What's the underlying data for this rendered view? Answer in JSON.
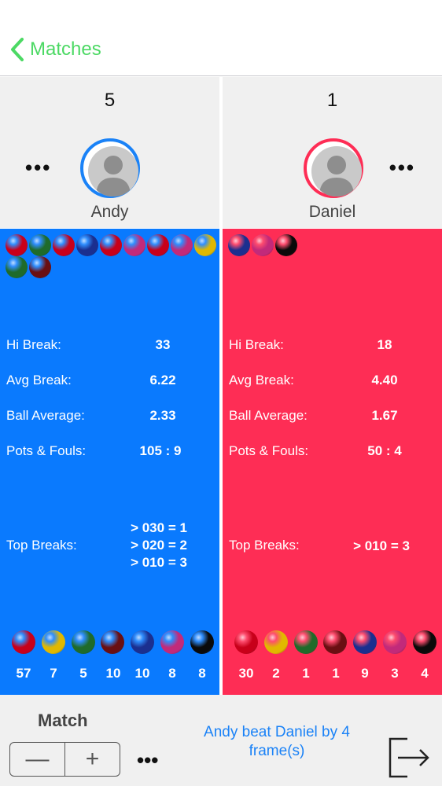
{
  "nav": {
    "back_label": "Matches"
  },
  "players": [
    {
      "score": "5",
      "name": "Andy",
      "panel_color": "#0a7afe",
      "ring_color": "#1a82f7",
      "potted_balls": [
        "red",
        "green",
        "red",
        "blue",
        "red",
        "pink",
        "red",
        "pink",
        "yellow",
        "green",
        "brown"
      ],
      "stats": {
        "hi_break_label": "Hi Break:",
        "hi_break": "33",
        "avg_break_label": "Avg Break:",
        "avg_break": "6.22",
        "ball_avg_label": "Ball Average:",
        "ball_avg": "2.33",
        "pots_fouls_label": "Pots & Fouls:",
        "pots_fouls": "105 : 9",
        "top_breaks_label": "Top Breaks:",
        "top_breaks": [
          "> 030 = 1",
          "> 020 = 2",
          "> 010 = 3"
        ]
      },
      "ball_counts": [
        "57",
        "7",
        "5",
        "10",
        "10",
        "8",
        "8"
      ]
    },
    {
      "score": "1",
      "name": "Daniel",
      "panel_color": "#fe2d55",
      "ring_color": "#fe2d55",
      "potted_balls": [
        "blue",
        "pink",
        "black"
      ],
      "stats": {
        "hi_break_label": "Hi Break:",
        "hi_break": "18",
        "avg_break_label": "Avg Break:",
        "avg_break": "4.40",
        "ball_avg_label": "Ball Average:",
        "ball_avg": "1.67",
        "pots_fouls_label": "Pots & Fouls:",
        "pots_fouls": "50 : 4",
        "top_breaks_label": "Top Breaks:",
        "top_breaks": [
          "> 010 = 3"
        ]
      },
      "ball_counts": [
        "30",
        "2",
        "1",
        "1",
        "9",
        "3",
        "4"
      ]
    }
  ],
  "ball_legend": [
    "red",
    "yellow",
    "green",
    "brown",
    "blue",
    "pink",
    "black"
  ],
  "ball_colors": {
    "red": "#c8001a",
    "green": "#1f6b2a",
    "blue": "#1b2f8f",
    "pink": "#c22a7a",
    "yellow": "#e1b800",
    "brown": "#6a0f12",
    "black": "#0a0a0a"
  },
  "footer": {
    "match_label": "Match",
    "minus": "—",
    "plus": "+",
    "more": "•••",
    "result": "Andy beat Daniel by 4 frame(s)"
  }
}
